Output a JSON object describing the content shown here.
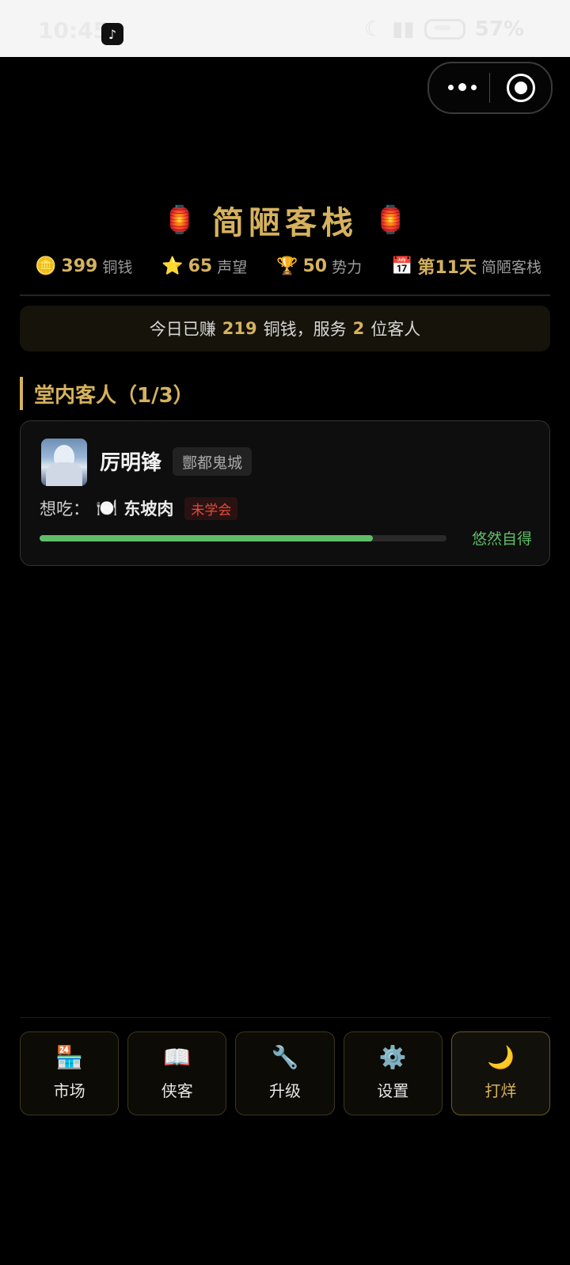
{
  "status_bar": {
    "time": "10:45",
    "battery": "57%"
  },
  "header": {
    "title": "简陋客栈",
    "lantern_icon": "red-lantern-icon"
  },
  "stats": [
    {
      "icon": "🪙",
      "icon_name": "coin-icon",
      "value": "399",
      "unit": "铜钱"
    },
    {
      "icon": "⭐",
      "icon_name": "star-icon",
      "value": "65",
      "unit": "声望"
    },
    {
      "icon": "🏆",
      "icon_name": "trophy-icon",
      "value": "50",
      "unit": "势力"
    },
    {
      "icon": "📅",
      "icon_name": "calendar-icon",
      "value": "第11天",
      "unit": "简陋客栈"
    }
  ],
  "earnings": {
    "prefix": "今日已赚",
    "coins": "219",
    "mid": "铜钱，服务",
    "guests": "2",
    "suffix": "位客人"
  },
  "section": {
    "title": "堂内客人（1/3）"
  },
  "guests": [
    {
      "name": "厉明锋",
      "origin": "酆都鬼城",
      "want_label": "想吃：",
      "dish_icon": "🍽️",
      "dish": "东坡肉",
      "dish_status": "未学会",
      "patience": 0.82,
      "mood": "悠然自得"
    }
  ],
  "nav": [
    {
      "icon": "🏪",
      "icon_name": "market-icon",
      "label": "市场"
    },
    {
      "icon": "📖",
      "icon_name": "book-icon",
      "label": "侠客"
    },
    {
      "icon": "🔧",
      "icon_name": "wrench-icon",
      "label": "升级"
    },
    {
      "icon": "⚙️",
      "icon_name": "gear-icon",
      "label": "设置"
    },
    {
      "icon": "🌙",
      "icon_name": "moon-icon",
      "label": "打烊"
    }
  ],
  "colors": {
    "accent_gold": "#d6b25e",
    "progress_green": "#5fbd68",
    "warning_red": "#e24b3b"
  }
}
